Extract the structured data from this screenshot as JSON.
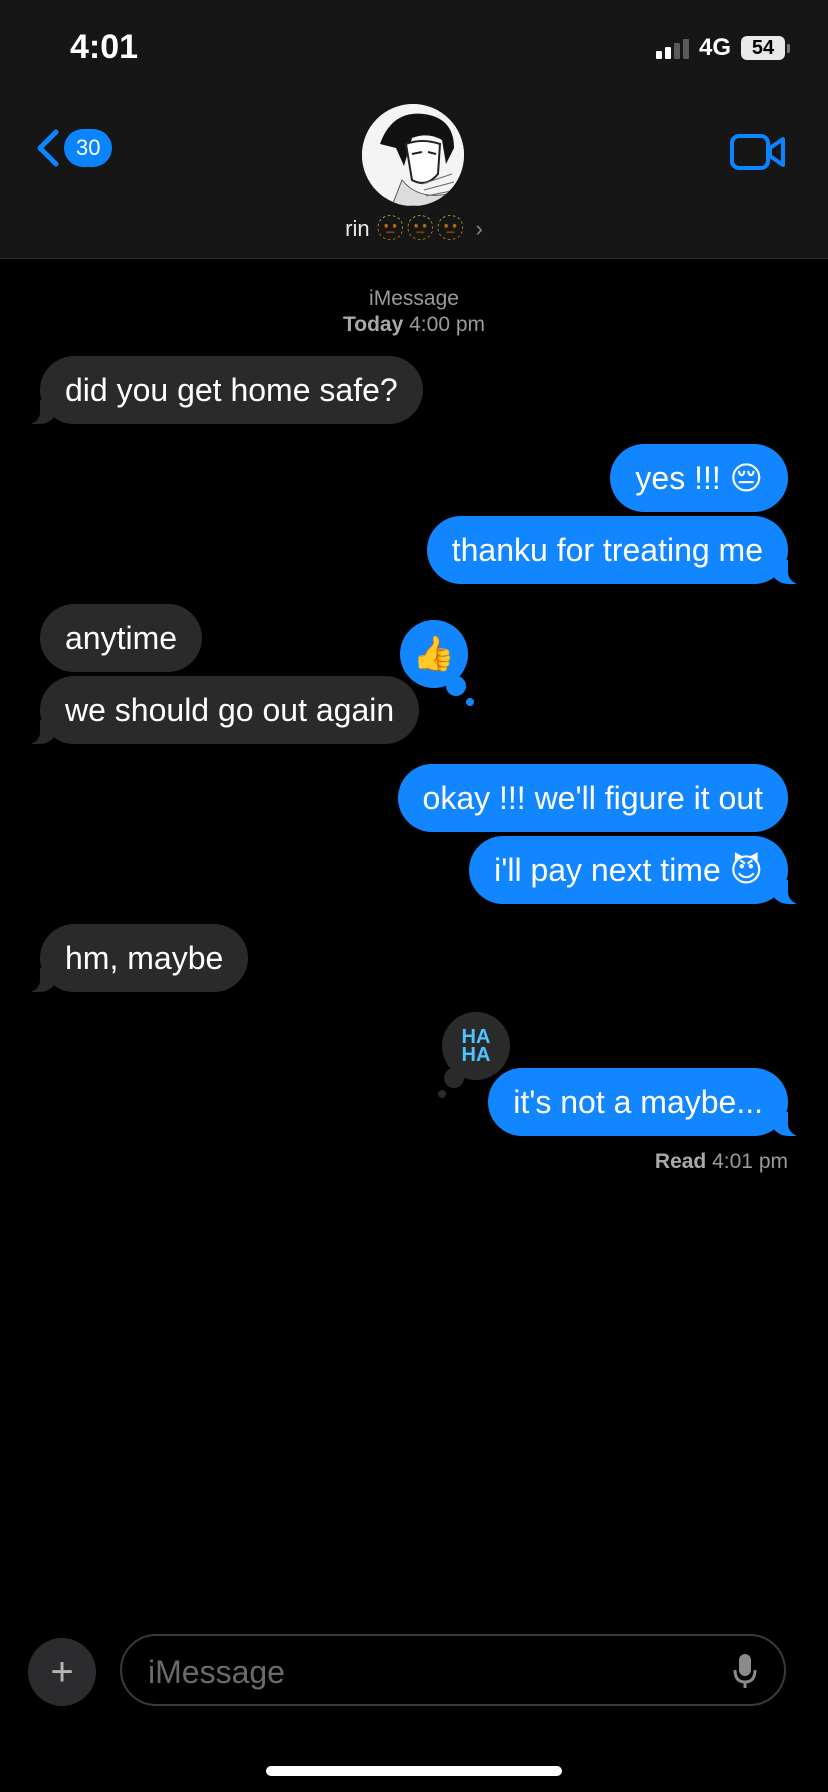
{
  "status_bar": {
    "time": "4:01",
    "network": "4G",
    "battery": "54"
  },
  "header": {
    "back_count": "30",
    "contact_name": "rin",
    "contact_emojis": "🫥🫥🫥",
    "chevron": "›"
  },
  "thread": {
    "service": "iMessage",
    "day": "Today",
    "time": "4:00 pm"
  },
  "messages": [
    {
      "from": "them",
      "text": "did you get home safe?"
    },
    {
      "from": "me",
      "text": "yes !!! 😔"
    },
    {
      "from": "me",
      "text": "thanku for treating me"
    },
    {
      "from": "them",
      "text": "anytime"
    },
    {
      "from": "them",
      "text": "we should go out again"
    },
    {
      "from": "me",
      "text": "okay !!! we'll figure it out"
    },
    {
      "from": "me",
      "text": "i'll pay next time 😈"
    },
    {
      "from": "them",
      "text": "hm, maybe"
    },
    {
      "from": "me",
      "text": "it's not a maybe..."
    }
  ],
  "tapbacks": {
    "like": "👍",
    "haha_top": "HA",
    "haha_bottom": "HA"
  },
  "receipt": {
    "label": "Read",
    "time": "4:01 pm"
  },
  "composer": {
    "placeholder": "iMessage",
    "plus": "+"
  },
  "colors": {
    "accent": "#1286ff",
    "incoming": "#2a2a2b"
  },
  "icons": [
    "back-chevron-icon",
    "video-call-icon",
    "microphone-icon",
    "plus-icon"
  ]
}
